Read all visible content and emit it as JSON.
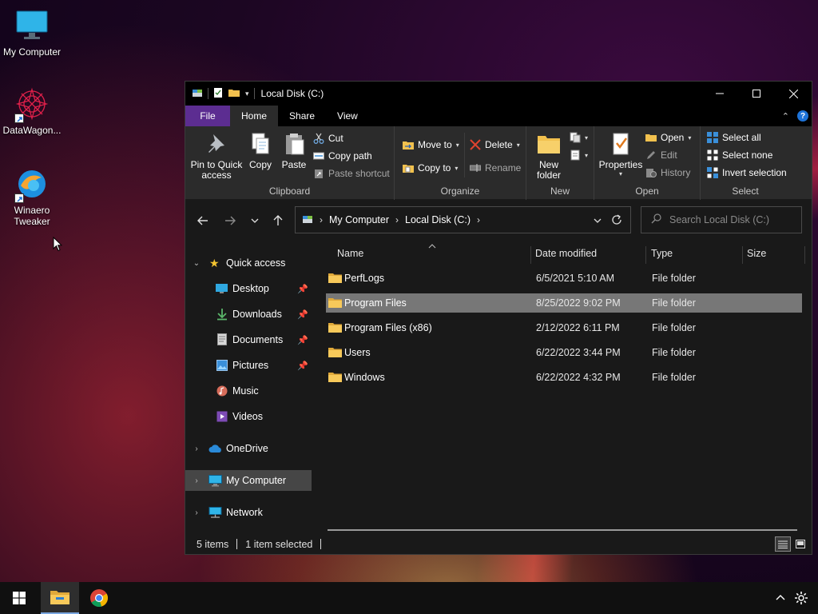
{
  "desktop": {
    "icons": [
      {
        "label": "My Computer",
        "icon": "monitor-icon"
      },
      {
        "label": "DataWagon...",
        "icon": "datawagon-icon",
        "shortcut": true
      },
      {
        "label": "Winaero Tweaker",
        "icon": "winaero-tweaker-icon",
        "shortcut": true
      }
    ]
  },
  "window": {
    "title": "Local Disk (C:)",
    "tabs": [
      "File",
      "Home",
      "Share",
      "View"
    ],
    "active_tab": "Home",
    "ribbon": {
      "clipboard": {
        "label": "Clipboard",
        "pin": "Pin to Quick access",
        "copy": "Copy",
        "paste": "Paste",
        "cut": "Cut",
        "copy_path": "Copy path",
        "paste_shortcut": "Paste shortcut"
      },
      "organize": {
        "label": "Organize",
        "move_to": "Move to",
        "copy_to": "Copy to",
        "delete": "Delete",
        "rename": "Rename"
      },
      "new": {
        "label": "New",
        "new_folder": "New folder"
      },
      "open": {
        "label": "Open",
        "properties": "Properties",
        "open": "Open",
        "edit": "Edit",
        "history": "History"
      },
      "select": {
        "label": "Select",
        "select_all": "Select all",
        "select_none": "Select none",
        "invert": "Invert selection"
      }
    },
    "address": {
      "crumbs": [
        "My Computer",
        "Local Disk (C:)"
      ]
    },
    "search": {
      "placeholder": "Search Local Disk (C:)"
    },
    "nav": {
      "quick_access": "Quick access",
      "items": [
        {
          "label": "Desktop",
          "pinned": true
        },
        {
          "label": "Downloads",
          "pinned": true
        },
        {
          "label": "Documents",
          "pinned": true
        },
        {
          "label": "Pictures",
          "pinned": true
        },
        {
          "label": "Music",
          "pinned": false
        },
        {
          "label": "Videos",
          "pinned": false
        }
      ],
      "onedrive": "OneDrive",
      "my_computer": "My Computer",
      "network": "Network"
    },
    "columns": [
      "Name",
      "Date modified",
      "Type",
      "Size"
    ],
    "files": [
      {
        "name": "PerfLogs",
        "date": "6/5/2021 5:10 AM",
        "type": "File folder",
        "selected": false
      },
      {
        "name": "Program Files",
        "date": "8/25/2022 9:02 PM",
        "type": "File folder",
        "selected": true
      },
      {
        "name": "Program Files (x86)",
        "date": "2/12/2022 6:11 PM",
        "type": "File folder",
        "selected": false
      },
      {
        "name": "Users",
        "date": "6/22/2022 3:44 PM",
        "type": "File folder",
        "selected": false
      },
      {
        "name": "Windows",
        "date": "6/22/2022 4:32 PM",
        "type": "File folder",
        "selected": false
      }
    ],
    "status": {
      "count": "5 items",
      "selected": "1 item selected"
    }
  },
  "colors": {
    "file_tab": "#5c2d91",
    "folder": "#f2c14e",
    "selection": "#777777",
    "accent": "#1e73d8"
  }
}
